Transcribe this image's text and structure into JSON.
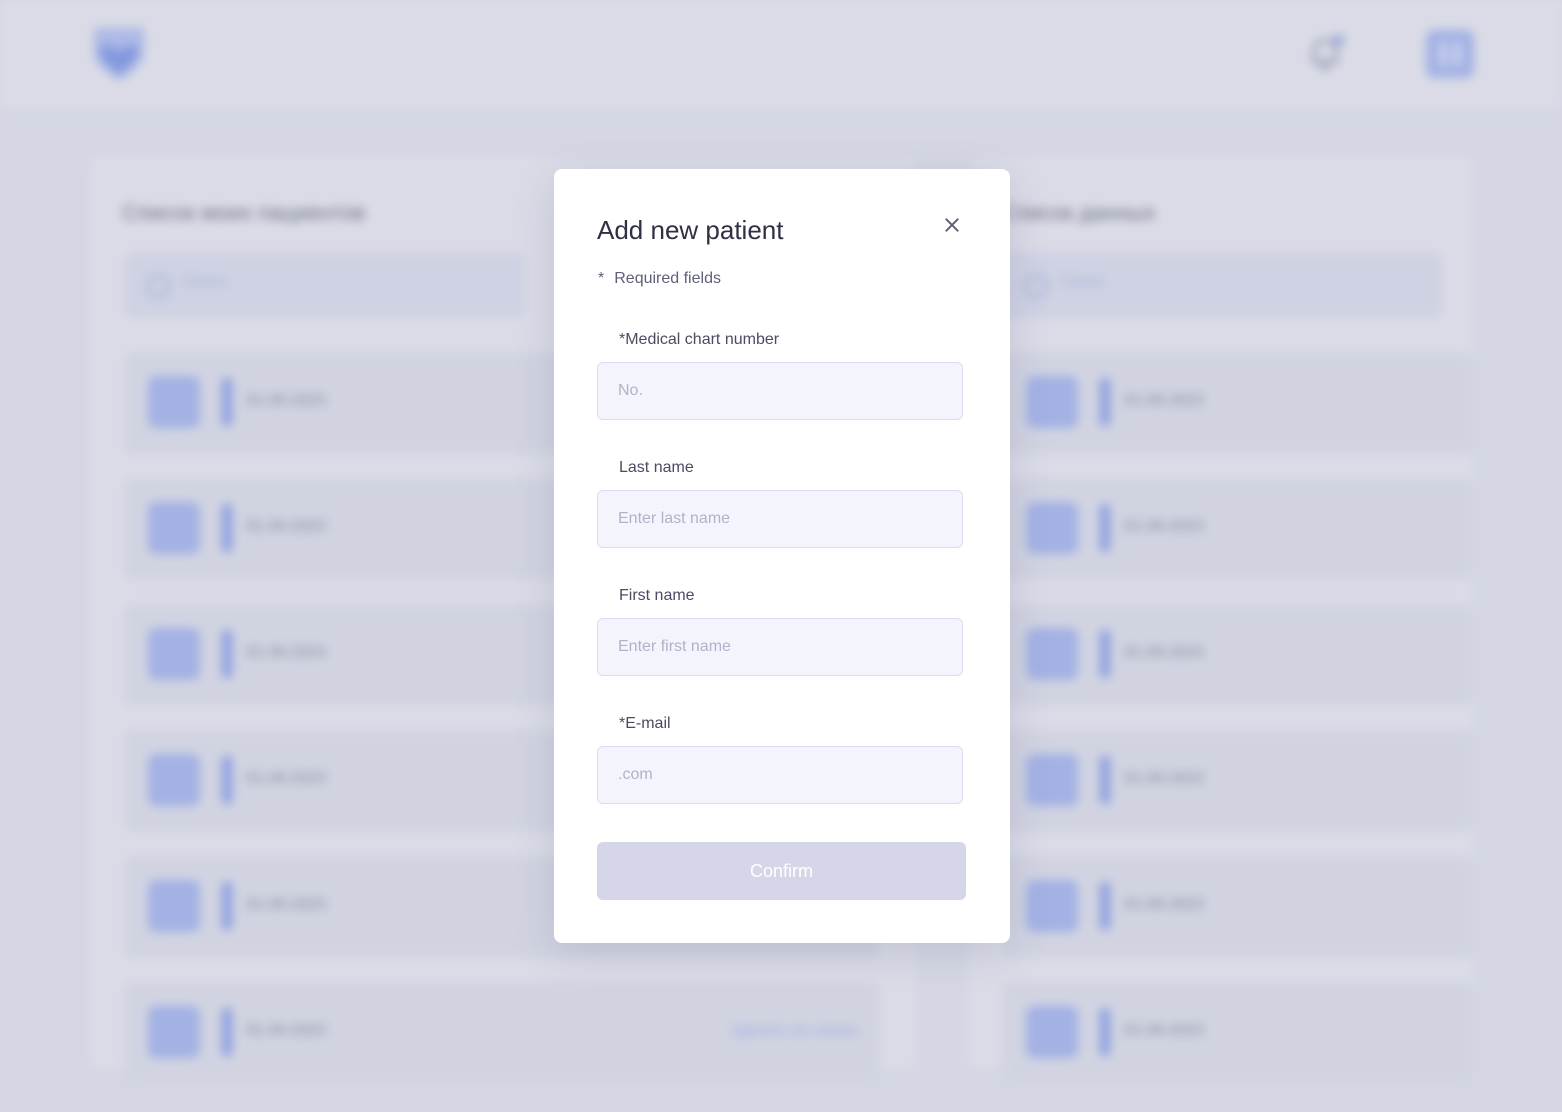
{
  "colors": {
    "accent": "#8fa4e8",
    "modal_bg": "#ffffff",
    "input_bg": "#f4f5fc",
    "button_disabled": "#d5d7e8"
  },
  "background": {
    "logo_icon": "heart-shield-icon",
    "notification_icon": "bell-icon",
    "left_panel": {
      "title": "Список моих пациентов",
      "search_placeholder": "Поиск",
      "rows": [
        {
          "text": "01.09.2023",
          "link": ""
        },
        {
          "text": "01.09.2023",
          "link": ""
        },
        {
          "text": "01.09.2023",
          "link": ""
        },
        {
          "text": "01.09.2023",
          "link": ""
        },
        {
          "text": "01.09.2023",
          "link": ""
        },
        {
          "text": "01.09.2023",
          "link": "Удалить из списка"
        }
      ]
    },
    "right_panel": {
      "title": "Список данных",
      "search_placeholder": "Поиск",
      "rows": [
        {
          "text": "01.09.2023"
        },
        {
          "text": "01.09.2023"
        },
        {
          "text": "01.09.2023"
        },
        {
          "text": "01.09.2023"
        },
        {
          "text": "01.09.2023"
        },
        {
          "text": "01.09.2023"
        }
      ]
    }
  },
  "modal": {
    "title": "Add new patient",
    "close_icon": "close-icon",
    "required_star": "*",
    "required_note": "Required fields",
    "fields": [
      {
        "label": "*Medical chart number",
        "placeholder": "No.",
        "value": ""
      },
      {
        "label": "Last name",
        "placeholder": "Enter last name",
        "value": ""
      },
      {
        "label": "First name",
        "placeholder": "Enter first name",
        "value": ""
      },
      {
        "label": "*E-mail",
        "placeholder": ".com",
        "value": ""
      }
    ],
    "confirm_label": "Confirm"
  }
}
